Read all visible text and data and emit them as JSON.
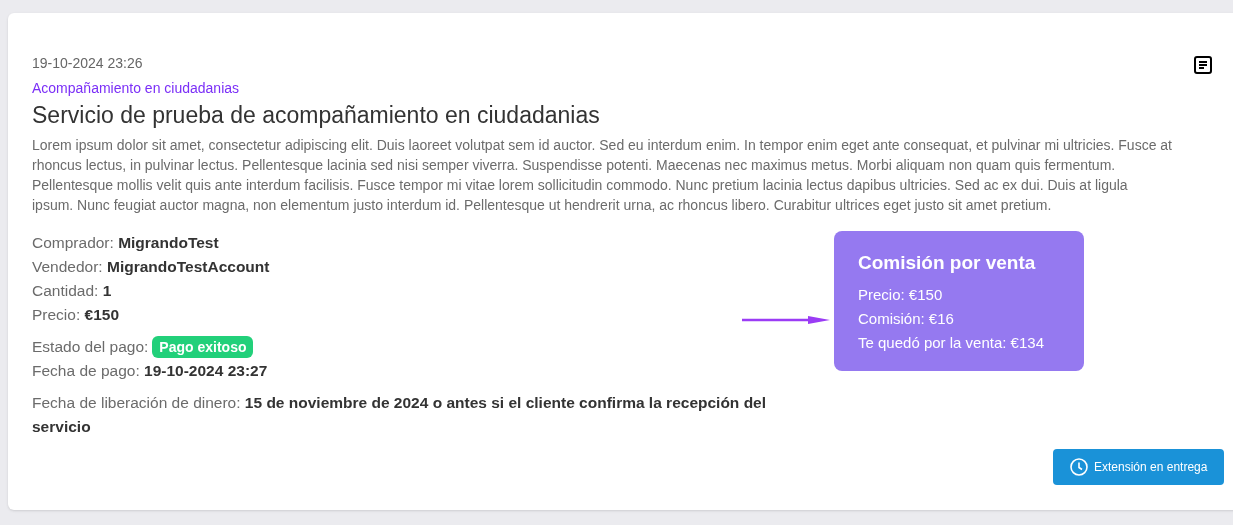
{
  "date": "19-10-2024 23:26",
  "category": "Acompañamiento en ciudadanias",
  "title": "Servicio de prueba de acompañamiento en ciudadanias",
  "description": "Lorem ipsum dolor sit amet, consectetur adipiscing elit. Duis laoreet volutpat sem id auctor. Sed eu interdum enim. In tempor enim eget ante consequat, et pulvinar mi ultricies. Fusce at rhoncus lectus, in pulvinar lectus. Pellentesque lacinia sed nisi semper viverra. Suspendisse potenti. Maecenas nec maximus metus. Morbi aliquam non quam quis fermentum. Pellentesque mollis velit quis ante interdum facilisis. Fusce tempor mi vitae lorem sollicitudin commodo. Nunc pretium lacinia lectus dapibus ultricies. Sed ac ex dui. Duis at ligula ipsum. Nunc feugiat auctor magna, non elementum justo interdum id. Pellentesque ut hendrerit urna, ac rhoncus libero. Curabitur ultrices eget justo sit amet pretium.",
  "detail_groups": [
    {
      "rows": [
        {
          "label": "Comprador:",
          "value": "MigrandoTest",
          "kind": "text"
        },
        {
          "label": "Vendedor:",
          "value": "MigrandoTestAccount",
          "kind": "text"
        },
        {
          "label": "Cantidad:",
          "value": "1",
          "kind": "text"
        },
        {
          "label": "Precio:",
          "value": "€150",
          "kind": "text"
        }
      ]
    },
    {
      "rows": [
        {
          "label": "Estado del pago:",
          "value": "Pago exitoso",
          "kind": "badge",
          "color": "#22d07a"
        },
        {
          "label": "Fecha de pago:",
          "value": "19-10-2024 23:27",
          "kind": "text"
        }
      ]
    },
    {
      "rows": [
        {
          "label": "Fecha de liberación de dinero:",
          "value": "15 de noviembre de 2024 o antes si el cliente confirma la recepción del servicio",
          "kind": "text"
        }
      ]
    }
  ],
  "commission": {
    "title": "Comisión por venta",
    "lines": [
      "Precio: €150",
      "Comisión: €16",
      "Te quedó por la venta: €134"
    ]
  },
  "action_button": "Extensión en entrega"
}
